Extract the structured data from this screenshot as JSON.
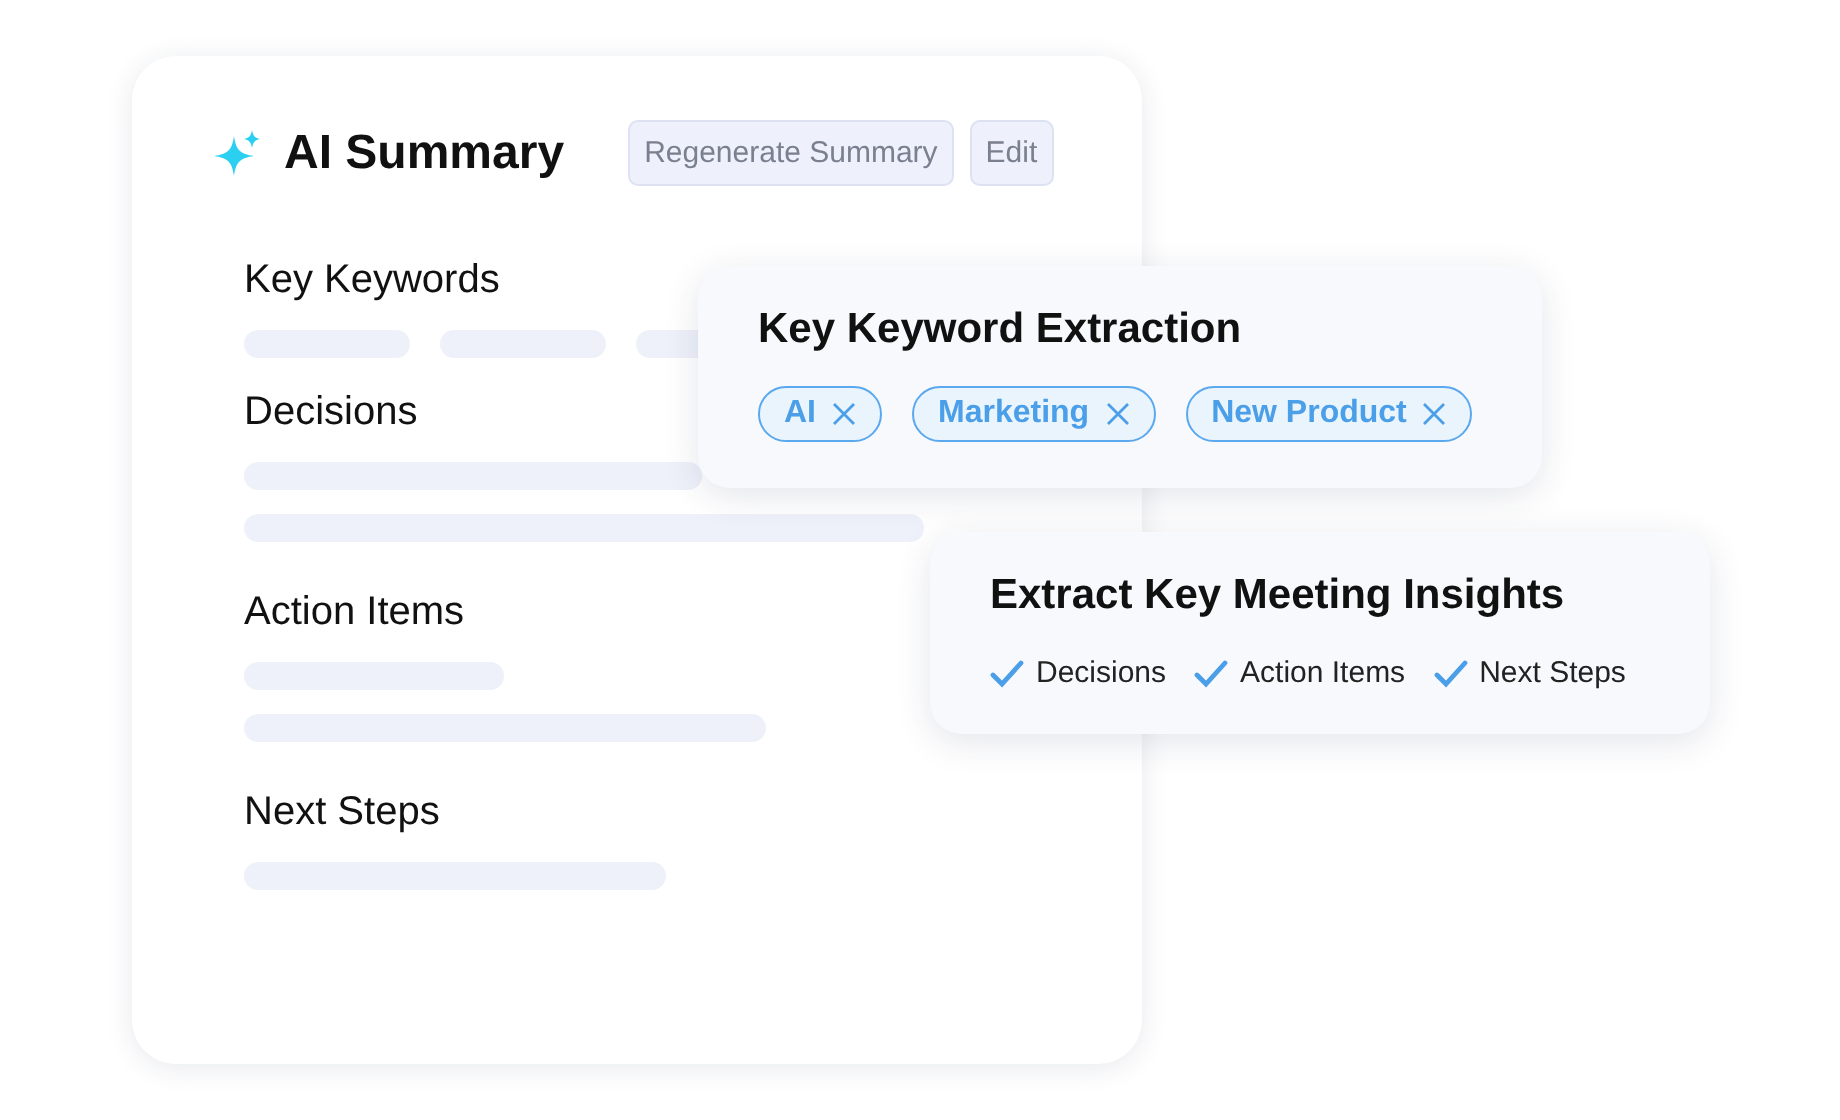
{
  "summary": {
    "title": "AI Summary",
    "buttons": [
      "Regenerate Summary",
      "Edit"
    ],
    "sections": [
      {
        "heading": "Key Keywords"
      },
      {
        "heading": "Decisions"
      },
      {
        "heading": "Action Items"
      },
      {
        "heading": "Next Steps"
      }
    ]
  },
  "keyword_card": {
    "title": "Key Keyword Extraction",
    "tags": [
      "AI",
      "Marketing",
      "New Product"
    ]
  },
  "insights_card": {
    "title": "Extract Key Meeting Insights",
    "items": [
      "Decisions",
      "Action Items",
      "Next Steps"
    ]
  }
}
